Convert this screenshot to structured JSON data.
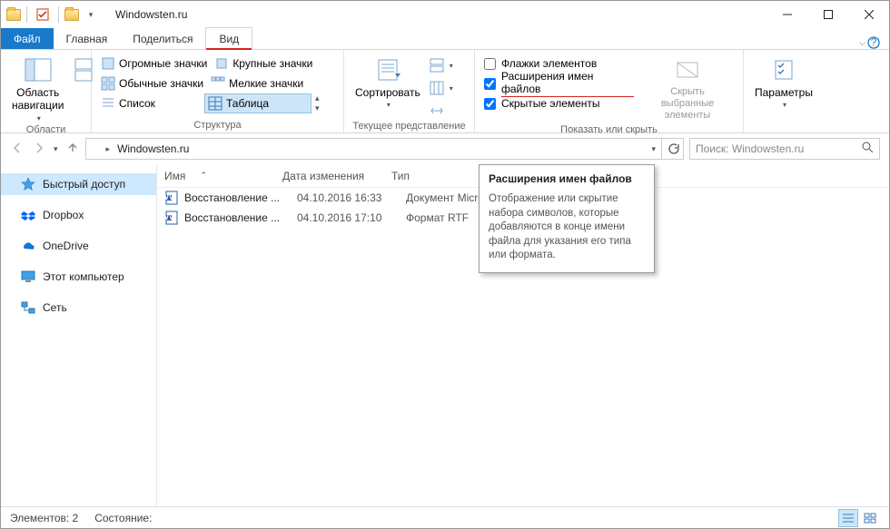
{
  "window": {
    "title": "Windowsten.ru"
  },
  "tabs": {
    "file": "Файл",
    "home": "Главная",
    "share": "Поделиться",
    "view": "Вид"
  },
  "ribbon": {
    "panes": {
      "nav_label": "Область\nнавигации",
      "group_panes": "Области"
    },
    "layout": {
      "huge": "Огромные значки",
      "large": "Крупные значки",
      "medium": "Обычные значки",
      "small": "Мелкие значки",
      "list": "Список",
      "table": "Таблица",
      "group": "Структура"
    },
    "current_view": {
      "sort": "Сортировать",
      "group": "Текущее представление"
    },
    "show_hide": {
      "checkboxes": "Флажки элементов",
      "extensions": "Расширения имен файлов",
      "hidden": "Скрытые элементы",
      "hide_selected": "Скрыть выбранные\nэлементы",
      "group": "Показать или скрыть"
    },
    "options": {
      "label": "Параметры"
    }
  },
  "address": {
    "path": "Windowsten.ru",
    "search_placeholder": "Поиск: Windowsten.ru"
  },
  "nav": {
    "quick": "Быстрый доступ",
    "dropbox": "Dropbox",
    "onedrive": "OneDrive",
    "thispc": "Этот компьютер",
    "network": "Сеть"
  },
  "columns": {
    "name": "Имя",
    "date": "Дата изменения",
    "type": "Тип"
  },
  "files": [
    {
      "name": "Восстановление ...",
      "date": "04.10.2016 16:33",
      "type": "Документ Micros..."
    },
    {
      "name": "Восстановление ...",
      "date": "04.10.2016 17:10",
      "type": "Формат RTF"
    }
  ],
  "tooltip": {
    "title": "Расширения имен файлов",
    "body": "Отображение или скрытие набора символов, которые добавляются в конце имени файла для указания его типа или формата."
  },
  "status": {
    "count": "Элементов: 2",
    "state": "Состояние:"
  }
}
